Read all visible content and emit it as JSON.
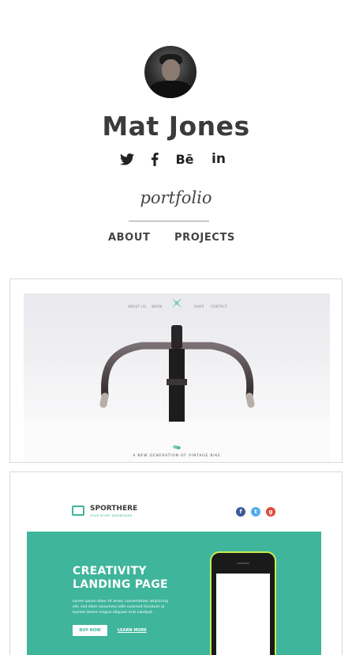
{
  "profile": {
    "name": "Mat Jones",
    "avatar": "avatar-photo"
  },
  "social": {
    "icons": [
      "twitter-icon",
      "facebook-icon",
      "behance-icon",
      "linkedin-icon"
    ],
    "behance_label": "Bē",
    "linkedin_label": "in"
  },
  "subtitle": "portfolio",
  "nav": {
    "about": "ABOUT",
    "projects": "PROJECTS"
  },
  "projects": [
    {
      "nav_items": [
        "ABOUT US",
        "WORK",
        "SHOP",
        "CONTACT"
      ],
      "tagline": "A NEW GENERATION OF VINTAGE BIKE"
    },
    {
      "brand_strong": "SPORT",
      "brand_light": "HERE",
      "brand_sub": "YOUR SPORT DASHBOARD",
      "social_colors": [
        "#3b5998",
        "#55acee",
        "#dd4b39"
      ],
      "headline_line1": "CREATIVITY",
      "headline_line2": "LANDING PAGE",
      "body": "Lorem ipsum dolor sit amet, consectetuer adipiscing elit, sed diam nonummy nibh euismod tincidunt ut laoreet dolore magna aliquam erat volutpat.",
      "primary_button": "BUY NOW",
      "secondary_link": "LEARN MORE",
      "accent_color": "#3fb59b"
    }
  ]
}
